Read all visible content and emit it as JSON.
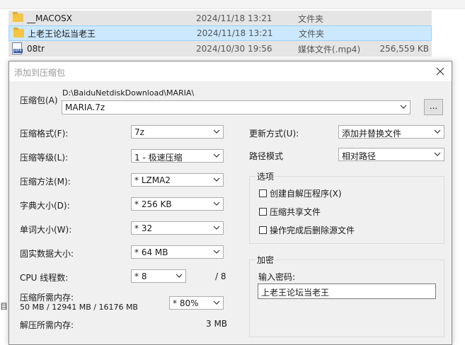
{
  "explorer": {
    "rows": [
      {
        "name": "__MACOSX",
        "date": "2024/11/18 13:21",
        "type": "文件夹",
        "size": "",
        "icon": "folder-icon"
      },
      {
        "name": "上老王论坛当老王",
        "date": "2024/11/18 13:21",
        "type": "文件夹",
        "size": "",
        "icon": "folder-icon"
      },
      {
        "name": "08tr",
        "date": "2024/10/30 19:56",
        "type": "媒体文件(.mp4)",
        "size": "256,559 KB",
        "icon": "mp4-file-icon"
      }
    ],
    "left_edge_text": "目"
  },
  "dialog": {
    "title": "添加到压缩包",
    "archive": {
      "label": "压缩包(A)",
      "path": "D:\\BaiduNetdiskDownload\\MARIA\\",
      "value": "MARIA.7z",
      "browse_label": "..."
    },
    "format": {
      "label": "压缩格式(F):",
      "value": "7z"
    },
    "level": {
      "label": "压缩等级(L):",
      "value": "1 - 极速压缩"
    },
    "method": {
      "label": "压缩方法(M):",
      "value": "* LZMA2"
    },
    "dict": {
      "label": "字典大小(D):",
      "value": "* 256 KB"
    },
    "word": {
      "label": "单词大小(W):",
      "value": "* 32"
    },
    "solid": {
      "label": "固实数据大小:",
      "value": "* 64 MB"
    },
    "threads": {
      "label": "CPU 线程数:",
      "value": "* 8",
      "max": "/ 8"
    },
    "mem_compress": {
      "label": "压缩所需内存:",
      "detail": "50 MB / 12941 MB / 16176 MB",
      "value": "* 80%"
    },
    "mem_decompress": {
      "label": "解压所需内存:",
      "value": "3 MB"
    },
    "update": {
      "label": "更新方式(U):",
      "value": "添加并替换文件"
    },
    "path_mode": {
      "label": "路径模式",
      "value": "相对路径"
    },
    "options": {
      "title": "选项",
      "items": [
        "创建自解压程序(X)",
        "压缩共享文件",
        "操作完成后删除源文件"
      ],
      "checked": [
        false,
        false,
        false
      ]
    },
    "encryption": {
      "title": "加密",
      "password_label": "输入密码:",
      "password_value": "上老王论坛当老王"
    }
  }
}
